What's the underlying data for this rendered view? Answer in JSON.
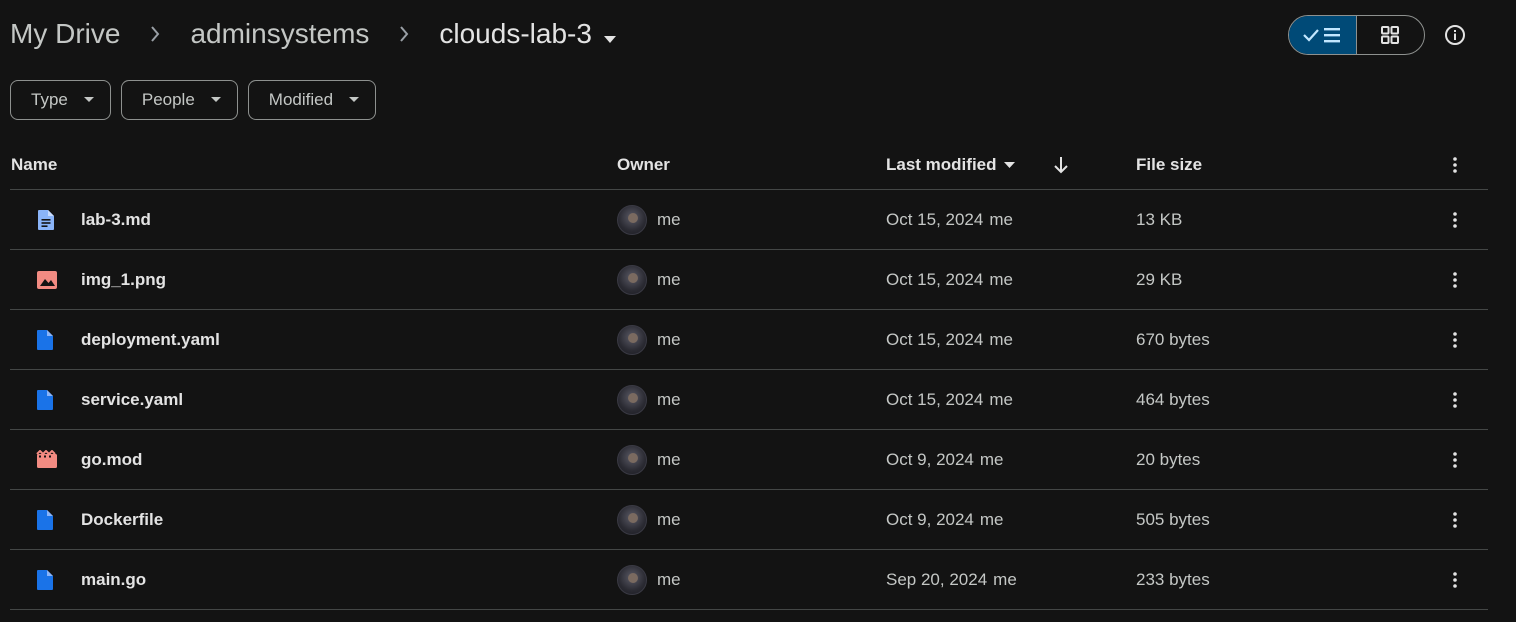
{
  "breadcrumb": {
    "items": [
      {
        "label": "My Drive"
      },
      {
        "label": "adminsystems"
      },
      {
        "label": "clouds-lab-3"
      }
    ]
  },
  "view_toggle": {
    "active": "list"
  },
  "filters": [
    {
      "label": "Type"
    },
    {
      "label": "People"
    },
    {
      "label": "Modified"
    }
  ],
  "columns": {
    "name": "Name",
    "owner": "Owner",
    "modified": "Last modified",
    "size": "File size"
  },
  "sort": {
    "column": "modified",
    "direction": "descending"
  },
  "colors": {
    "doc_blue": "#8ab4f8",
    "file_blue": "#1a73e8",
    "image_red": "#f28b82",
    "video_red": "#f28b82",
    "active_toggle": "#004a77"
  },
  "files": [
    {
      "name": "lab-3.md",
      "icon": "document-icon",
      "owner": "me",
      "modified_date": "Oct 15, 2024",
      "modified_by": "me",
      "size": "13 KB"
    },
    {
      "name": "img_1.png",
      "icon": "image-icon",
      "owner": "me",
      "modified_date": "Oct 15, 2024",
      "modified_by": "me",
      "size": "29 KB"
    },
    {
      "name": "deployment.yaml",
      "icon": "file-icon",
      "owner": "me",
      "modified_date": "Oct 15, 2024",
      "modified_by": "me",
      "size": "670 bytes"
    },
    {
      "name": "service.yaml",
      "icon": "file-icon",
      "owner": "me",
      "modified_date": "Oct 15, 2024",
      "modified_by": "me",
      "size": "464 bytes"
    },
    {
      "name": "go.mod",
      "icon": "video-icon",
      "owner": "me",
      "modified_date": "Oct 9, 2024",
      "modified_by": "me",
      "size": "20 bytes"
    },
    {
      "name": "Dockerfile",
      "icon": "file-icon",
      "owner": "me",
      "modified_date": "Oct 9, 2024",
      "modified_by": "me",
      "size": "505 bytes"
    },
    {
      "name": "main.go",
      "icon": "file-icon",
      "owner": "me",
      "modified_date": "Sep 20, 2024",
      "modified_by": "me",
      "size": "233 bytes"
    }
  ]
}
